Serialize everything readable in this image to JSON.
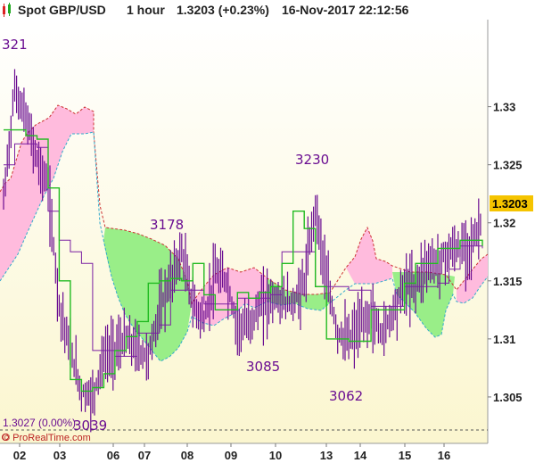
{
  "header": {
    "symbol": "Spot GBP/USD",
    "timeframe": "1 hour",
    "price_change": "1.3203 (+0.23%)",
    "datetime": "16-Nov-2017 22:12:56",
    "icon": "candlestick-icon"
  },
  "credit": "© ProRealTime.com",
  "reference_label": "1.3027 (0.00%)",
  "current_price_label": "1.3203",
  "colors": {
    "candles": "#6a0d91",
    "kijun": "#7b1fa2",
    "tenkan": "#22bb22",
    "senkou_a": "#cc3333",
    "senkou_b": "#33aacc",
    "cloud_bull": "#99ee88",
    "cloud_bear": "#ffbbdd",
    "price_tag": "#f5c400"
  },
  "chart_data": {
    "type": "line",
    "title": "Spot GBP/USD",
    "ylim": [
      1.301,
      1.3375
    ],
    "y_ticks": [
      "1.305",
      "1.31",
      "1.315",
      "1.32",
      "1.325",
      "1.33"
    ],
    "x_ticks": [
      "02",
      "03",
      "06",
      "07",
      "08",
      "09",
      "10",
      "13",
      "14",
      "15",
      "16"
    ],
    "reference_line": 1.3027,
    "last_price": 1.3203,
    "annotations": [
      "321",
      "3178",
      "3230",
      "3085",
      "3062",
      "3039"
    ],
    "series": [
      {
        "role": "price",
        "values": [
          1.322,
          1.3315,
          1.329,
          1.3255,
          1.323,
          1.313,
          1.309,
          1.3055,
          1.305,
          1.3085,
          1.309,
          1.31,
          1.309,
          1.3085,
          1.3125,
          1.315,
          1.3175,
          1.313,
          1.3115,
          1.3155,
          1.315,
          1.311,
          1.3112,
          1.3128,
          1.3135,
          1.3133,
          1.313,
          1.3148,
          1.3215,
          1.315,
          1.3105,
          1.3098,
          1.3112,
          1.312,
          1.3105,
          1.3125,
          1.3145,
          1.3148,
          1.3165,
          1.3165,
          1.3175,
          1.3178,
          1.318,
          1.3203
        ]
      },
      {
        "role": "kijun",
        "values": [
          1.325,
          1.3268,
          1.3268,
          1.3265,
          1.321,
          1.3185,
          1.3175,
          1.3165,
          1.309,
          1.309,
          1.3085,
          1.3085,
          1.3105,
          1.3105,
          1.3112,
          1.3142,
          1.3142,
          1.3142,
          1.313,
          1.313,
          1.313,
          1.3135,
          1.3135,
          1.3135,
          1.3138,
          1.3175,
          1.3175,
          1.3175,
          1.3145,
          1.3145,
          1.3145,
          1.3142,
          1.3142,
          1.3128,
          1.3128,
          1.3128,
          1.3145,
          1.3145,
          1.3145,
          1.3148,
          1.316,
          1.318,
          1.318,
          1.3178
        ]
      },
      {
        "role": "tenkan",
        "values": [
          1.328,
          1.328,
          1.3275,
          1.3272,
          1.323,
          1.315,
          1.3065,
          1.3055,
          1.3058,
          1.307,
          1.309,
          1.3102,
          1.3115,
          1.3148,
          1.315,
          1.3152,
          1.315,
          1.3165,
          1.3138,
          1.3125,
          1.3125,
          1.314,
          1.3135,
          1.314,
          1.3145,
          1.3165,
          1.321,
          1.3195,
          1.3145,
          1.31,
          1.31,
          1.3098,
          1.3098,
          1.3125,
          1.3125,
          1.3125,
          1.3148,
          1.3165,
          1.3165,
          1.3178,
          1.3178,
          1.3185,
          1.3185,
          1.318
        ]
      }
    ]
  }
}
